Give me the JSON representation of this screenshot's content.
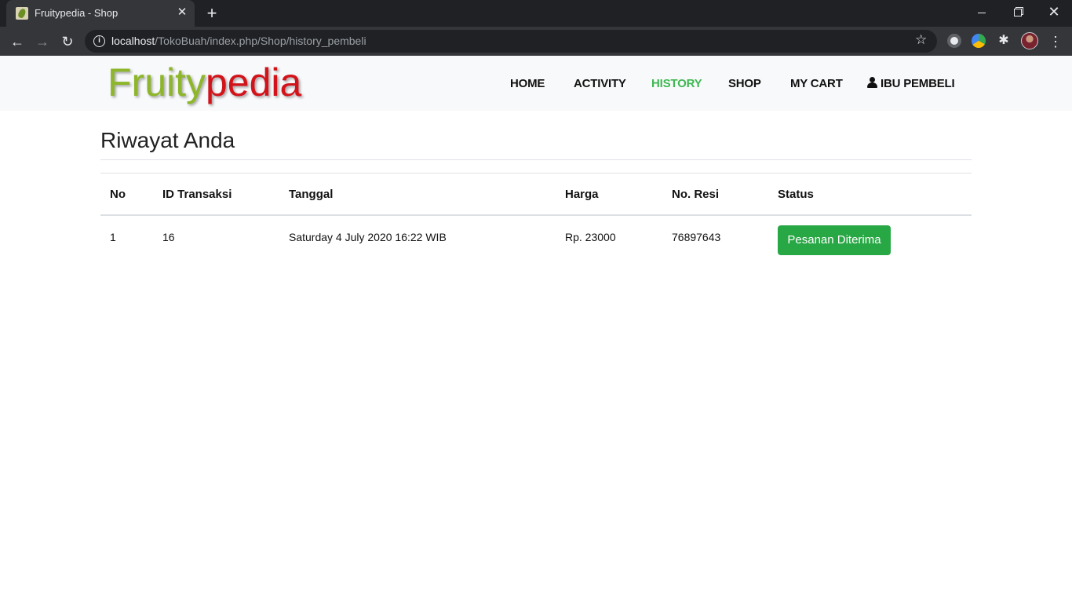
{
  "browser": {
    "tab_title": "Fruitypedia - Shop",
    "url_host": "localhost",
    "url_path": "/TokoBuah/index.php/Shop/history_pembeli",
    "icons": [
      "site-favicon-icon",
      "close-icon",
      "plus-icon",
      "back-icon",
      "forward-icon",
      "reload-icon",
      "info-icon",
      "star-icon",
      "extension-icon",
      "puzzle-icon",
      "avatar",
      "more-vert-icon"
    ]
  },
  "site": {
    "brand_part1": "Fruity",
    "brand_part2": "pedia",
    "brand_colors": {
      "part1": "#8db62a",
      "part2": "#d3131a"
    },
    "nav": {
      "home": "HOME",
      "activity": "ACTIVITY",
      "history": "HISTORY",
      "shop": "SHOP",
      "cart": "MY CART",
      "user": "IBU PEMBELI"
    },
    "active_nav": "HISTORY",
    "active_color": "#3fb852"
  },
  "page": {
    "title": "Riwayat Anda",
    "table": {
      "headers": {
        "no": "No",
        "id": "ID Transaksi",
        "date": "Tanggal",
        "price": "Harga",
        "receipt": "No. Resi",
        "status": "Status"
      },
      "rows": [
        {
          "no": "1",
          "id": "16",
          "date": "Saturday 4 July 2020 16:22 WIB",
          "price": "Rp. 23000",
          "receipt": "76897643",
          "status": "Pesanan Diterima"
        }
      ]
    },
    "status_color": "#28a745"
  }
}
